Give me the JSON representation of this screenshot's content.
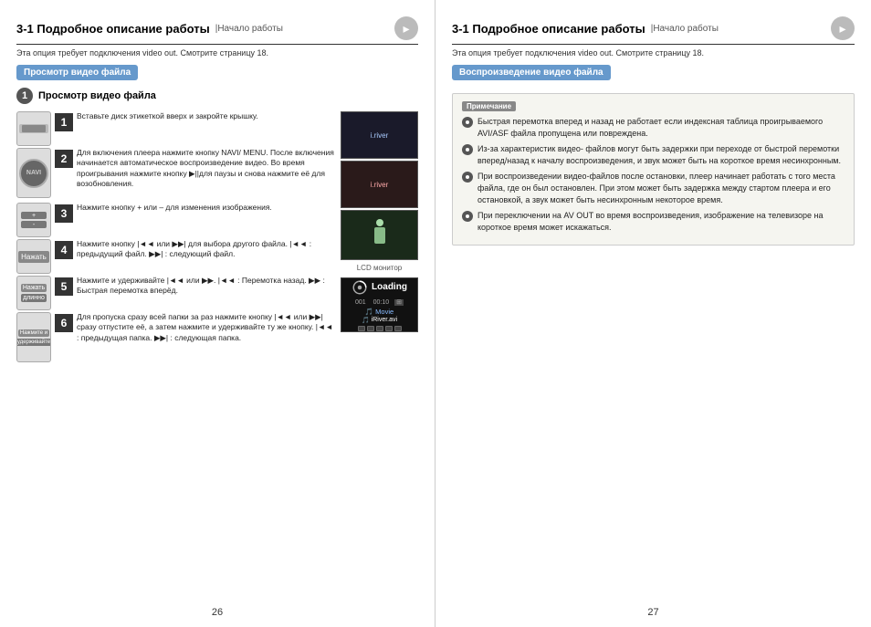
{
  "left_page": {
    "title": "3-1 Подробное описание работы",
    "subtitle": "Начало работы",
    "description": "Эта опция требует подключения video out. Смотрите страницу 18.",
    "section_header": "Просмотр видео файла",
    "subsection_title": "Просмотр видео файла",
    "page_number": "26",
    "steps": [
      {
        "number": "1",
        "text": "Вставьте диск этикеткой вверх и закройте крышку."
      },
      {
        "number": "2",
        "text": "Для включения плеера нажмите кнопку NAVI/ MENU. После включения начинается автоматическое воспроизведение видео. Во время проигрывания нажмите кнопку ▶||для паузы и снова нажмите её для возобновления."
      },
      {
        "number": "3",
        "text": "Нажмите кнопку + или – для изменения изображения."
      },
      {
        "number": "4",
        "text": "Нажмите кнопку |◄◄ или ▶▶| для выбора другого файла. |◄◄ : предыдущий файл. ▶▶| : следующий файл."
      },
      {
        "number": "5",
        "text": "Нажмите и удерживайте |◄◄ или ▶▶. |◄◄ : Перемотка назад. ▶▶ : Быстрая перемотка вперёд."
      },
      {
        "number": "6",
        "text": "Для пропуска сразу всей папки за раз нажмите кнопку |◄◄ или ▶▶| сразу отпустите её, а затем нажмите и удерживайте ту же кнопку. |◄◄ : предыдущая папка. ▶▶| : следующая папка."
      }
    ],
    "lcd_label": "LCD монитор",
    "loading_text": "Loading"
  },
  "right_page": {
    "title": "3-1 Подробное описание работы",
    "subtitle": "Начало работы",
    "description": "Эта опция требует подключения video out. Смотрите страницу 18.",
    "section_header": "Воспроизведение видео файла",
    "page_number": "27",
    "note_header": "Примечание",
    "notes": [
      "Быстрая перемотка вперед и назад не работает если индексная таблица проигрываемого AVI/ASF файла пропущена или повреждена.",
      "Из-за характеристик видео- файлов могут быть задержки при переходе от быстрой перемотки вперед/назад к началу воспроизведения, и звук может быть на короткое время несинхронным.",
      "При воспроизведении видео-файлов после остановки, плеер начинает работать с того места файла, где он был остановлен. При этом может быть задержка между стартом плеера и его остановкой, а звук может быть несинхронным некоторое время.",
      "При переключении на AV OUT во время воспроизведения, изображение на телевизоре на короткое время может искажаться."
    ]
  }
}
